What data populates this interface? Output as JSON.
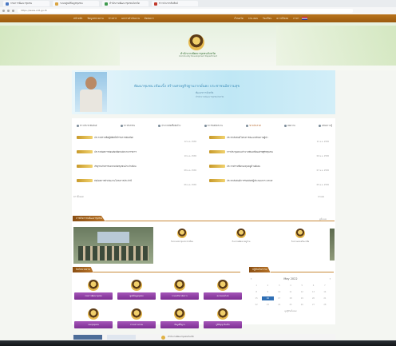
{
  "browser": {
    "tabs": [
      {
        "title": "กรมการพัฒนาชุมชน",
        "color": "#4a78c2"
      },
      {
        "title": "ระบบศูนย์ข้อมูลชุมชน",
        "color": "#d9a441"
      },
      {
        "title": "สำนักงานพัฒนาชุมชนจังหวัด",
        "color": "#3f9a4e"
      },
      {
        "title": "ข่าวประชาสัมพันธ์",
        "color": "#c0392b"
      }
    ],
    "url": "https://www.cdd.go.th"
  },
  "nav": {
    "left": [
      "หน้าหลัก",
      "ข้อมูลหน่วยงาน",
      "ข่าวสาร",
      "ผลการดำเนินงาน",
      "ติดต่อเรา"
    ],
    "right": [
      "เว็บบอร์ด",
      "ถาม-ตอบ",
      "ร้องเรียน",
      "ดาวน์โหลด",
      "ภาษา"
    ]
  },
  "header": {
    "org_name": "สำนักงานพัฒนาชุมชนจังหวัด",
    "org_sub": "Community Development Department"
  },
  "banner": {
    "title": "พัฒนาชุมชน เข้มแข็ง สร้างเศรษฐกิจฐานรากมั่นคง ประชาชนมีความสุข",
    "sub1": "พัฒนาการจังหวัด",
    "sub2": "สำนักงานพัฒนาชุมชนจังหวัด"
  },
  "tabs": [
    {
      "label": "ข่าวประชาสัมพันธ์",
      "active": false
    },
    {
      "label": "ข่าวกิจกรรม",
      "active": false
    },
    {
      "label": "ประกาศจัดซื้อจัดจ้าง",
      "active": false
    },
    {
      "label": "ข่าวรับสมัครงาน",
      "active": false
    },
    {
      "label": "ข่าวประกาศ",
      "active": true
    },
    {
      "label": "บทความ",
      "active": false
    },
    {
      "label": "คลังความรู้",
      "active": false
    }
  ],
  "news": [
    {
      "text": "ประกาศรายชื่อผู้มีสิทธิ์เข้ารับการคัดเลือก",
      "date": "12 พ.ค. 2565"
    },
    {
      "text": "ประชาสัมพันธ์โครงการพัฒนาศักยภาพผู้นำ",
      "date": "11 พ.ค. 2565"
    },
    {
      "text": "ประกาศผลการสอบคัดเลือกพนักงานราชการ",
      "date": "10 พ.ค. 2565"
    },
    {
      "text": "การประชุมคณะทำงานขับเคลื่อนเศรษฐกิจชุมชน",
      "date": "09 พ.ค. 2565"
    },
    {
      "text": "เชิญร่วมกิจกรรมตลาดนัดชุมชนประจำเดือน",
      "date": "08 พ.ค. 2565"
    },
    {
      "text": "ประกาศรายชื่อกองทุนหมู่บ้านดีเด่น",
      "date": "07 พ.ค. 2565"
    },
    {
      "text": "สรุปผลการดำเนินงานโครงการประจำปี",
      "date": "06 พ.ค. 2565"
    },
    {
      "text": "ประชาสัมพันธ์การรับสมัครผู้ประกอบการ OTOP",
      "date": "05 พ.ค. 2565"
    }
  ],
  "more_left": "ข่าวทั้งหมด",
  "more_right": "อ่านต่อ",
  "activities": {
    "heading": "ภาพกิจกรรมพัฒนาชุมชน",
    "more": "ดูทั้งหมด",
    "items": [
      {
        "text": "กิจกรรมประชุมประจำเดือน"
      },
      {
        "text": "กิจกรรมพัฒนาหมู่บ้าน"
      },
      {
        "text": "กิจกรรมส่งเสริมอาชีพ"
      }
    ]
  },
  "links": {
    "heading": "ลิงก์หน่วยงาน",
    "items": [
      "กรมการพัฒนาชุมชน",
      "ศูนย์ข้อมูลชุมชน",
      "ระบบบริหารจัดการ",
      "ตลาดออนไลน์",
      "กองทุนชุมชน",
      "ระบบสารบรรณ",
      "ข้อมูลพื้นฐาน",
      "ภูมิปัญญาท้องถิ่น"
    ]
  },
  "calendar": {
    "heading": "ปฏิทินกิจกรรม",
    "month": "May 2022",
    "days": [
      "1",
      "2",
      "3",
      "4",
      "5",
      "6",
      "7",
      "8",
      "9",
      "10",
      "11",
      "12",
      "13",
      "14",
      "15",
      "16",
      "17",
      "18",
      "19",
      "20",
      "21",
      "22",
      "23",
      "24",
      "25",
      "26",
      "27",
      "28"
    ],
    "today_index": 15,
    "footer": "ดูปฏิทินทั้งหมด"
  },
  "footer": {
    "label": "สำนักงานพัฒนาชุมชนจังหวัด"
  },
  "colors": {
    "nav": "#9a5a10",
    "banner": "#bfe7f5",
    "purple": "#7d2e93",
    "accent": "#b05b1a"
  }
}
